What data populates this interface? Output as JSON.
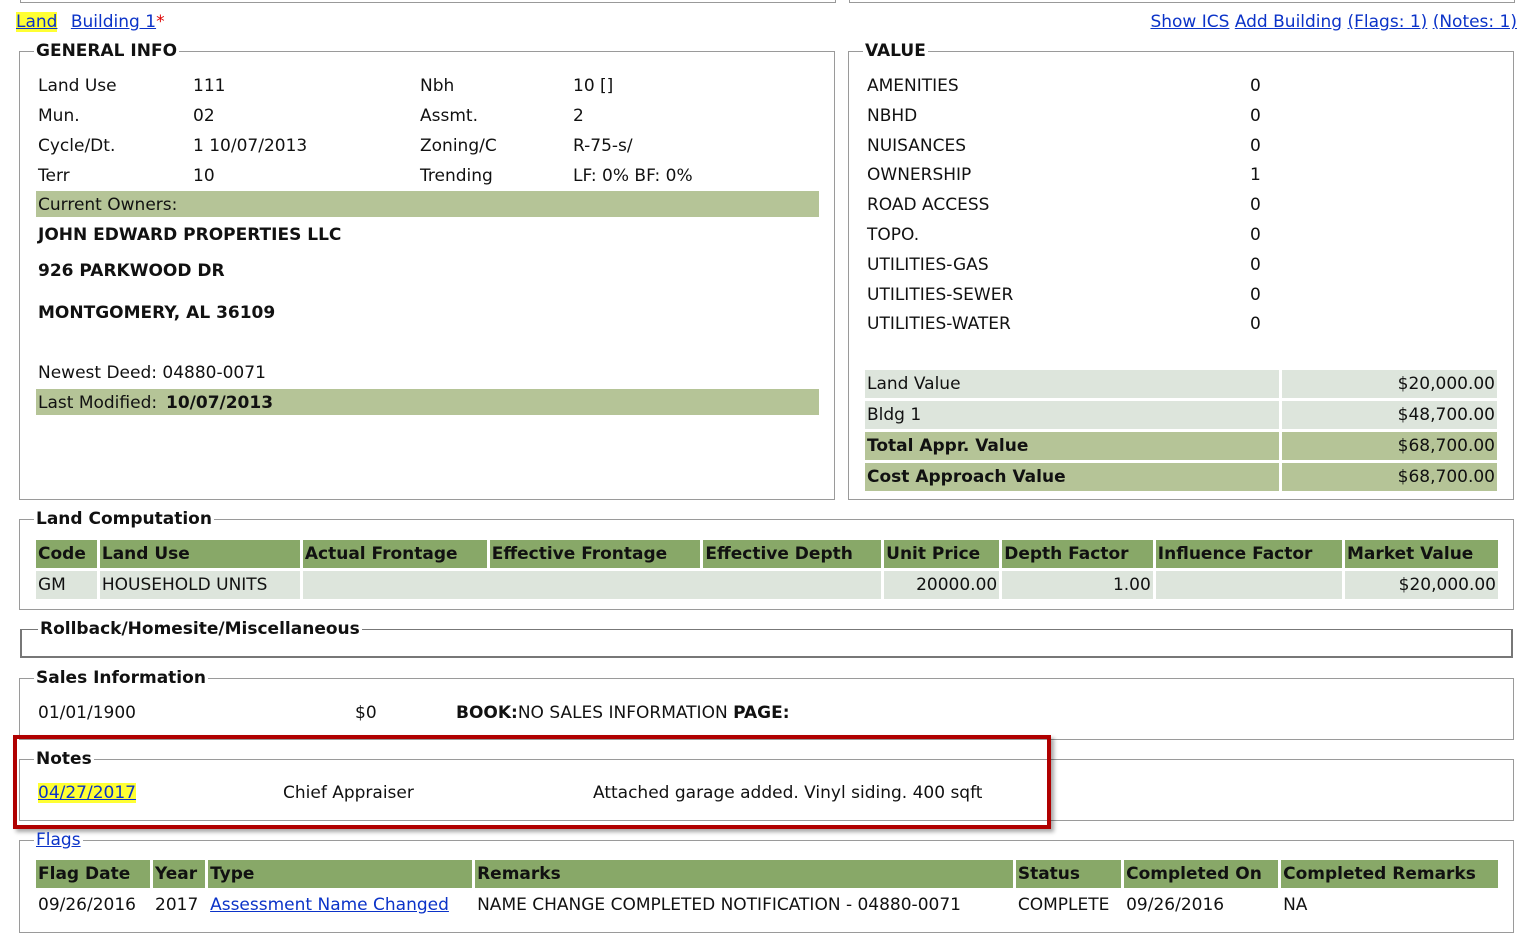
{
  "nav": {
    "land": "Land",
    "building": "Building 1",
    "building_mark": "*",
    "show_ics": "Show ICS",
    "add_building": "Add Building",
    "flags": "(Flags: 1)",
    "notes": "(Notes: 1)"
  },
  "general": {
    "legend": "GENERAL INFO",
    "land_use_label": "Land Use",
    "land_use": "111",
    "nbh_label": "Nbh",
    "nbh": "10 []",
    "mun_label": "Mun.",
    "mun": "02",
    "assmt_label": "Assmt.",
    "assmt": "2",
    "cycle_label": "Cycle/Dt.",
    "cycle": "1 10/07/2013",
    "zoning_label": "Zoning/C",
    "zoning": "R-75-s/",
    "terr_label": "Terr",
    "terr": "10",
    "trending_label": "Trending",
    "trending": "LF: 0% BF: 0%",
    "owners_label": "Current Owners:",
    "owner_name": "JOHN EDWARD PROPERTIES LLC",
    "owner_addr1": "926 PARKWOOD DR",
    "owner_addr2": "MONTGOMERY, AL 36109",
    "deed_label": "Newest Deed:",
    "deed": "04880-0071",
    "modified_label": "Last Modified:",
    "modified": "10/07/2013"
  },
  "value": {
    "legend": "VALUE",
    "factors": [
      {
        "name": "AMENITIES",
        "val": "0"
      },
      {
        "name": "NBHD",
        "val": "0"
      },
      {
        "name": "NUISANCES",
        "val": "0"
      },
      {
        "name": "OWNERSHIP",
        "val": "1"
      },
      {
        "name": "ROAD ACCESS",
        "val": "0"
      },
      {
        "name": "TOPO.",
        "val": "0"
      },
      {
        "name": "UTILITIES-GAS",
        "val": "0"
      },
      {
        "name": "UTILITIES-SEWER",
        "val": "0"
      },
      {
        "name": "UTILITIES-WATER",
        "val": "0"
      }
    ],
    "land_value_label": "Land Value",
    "land_value": "$20,000.00",
    "bldg_label": "Bldg 1",
    "bldg_value": "$48,700.00",
    "total_label": "Total Appr. Value",
    "total_value": "$68,700.00",
    "cost_label": "Cost Approach Value",
    "cost_value": "$68,700.00"
  },
  "land_comp": {
    "legend": "Land Computation",
    "headers": [
      "Code",
      "Land Use",
      "Actual Frontage",
      "Effective Frontage",
      "Effective Depth",
      "Unit Price",
      "Depth Factor",
      "Influence Factor",
      "Market Value"
    ],
    "row": [
      "GM",
      "HOUSEHOLD UNITS",
      "",
      "",
      "",
      "20000.00",
      "1.00",
      "",
      "$20,000.00"
    ]
  },
  "rollback": {
    "legend": "Rollback/Homesite/Miscellaneous"
  },
  "sales": {
    "legend": "Sales Information",
    "date": "01/01/1900",
    "price": "$0",
    "book_label": "BOOK:",
    "book": "NO SALES INFORMATION",
    "page_label": "PAGE:"
  },
  "notes": {
    "legend": "Notes",
    "date": "04/27/2017",
    "author": "Chief Appraiser",
    "text": "Attached garage added. Vinyl siding. 400 sqft"
  },
  "flags": {
    "legend": "Flags",
    "headers": [
      "Flag Date",
      "Year",
      "Type",
      "Remarks",
      "Status",
      "Completed On",
      "Completed Remarks"
    ],
    "row": [
      "09/26/2016",
      "2017",
      "Assessment Name Changed",
      "NAME CHANGE COMPLETED NOTIFICATION - 04880-0071",
      "COMPLETE",
      "09/26/2016",
      "NA"
    ]
  },
  "colors": {
    "highlight": "#ffff33",
    "header_green": "#88a868",
    "row_green": "#b5c497",
    "row_light": "#dde5dc",
    "annotation_red": "#b00000"
  }
}
